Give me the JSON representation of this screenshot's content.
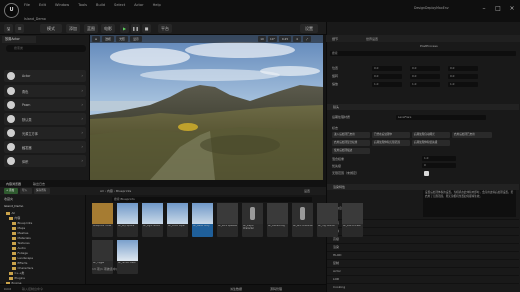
{
  "app": {
    "logo_text": "U",
    "project_name": "Island_Demo",
    "project_badge": "DesignDeployMaxEnv",
    "menu": [
      "File",
      "Edit",
      "Window",
      "Tools",
      "Build",
      "Select",
      "Actor",
      "Help"
    ]
  },
  "toolbar": {
    "mode_label": "选择模式",
    "play_icon": "▶",
    "pause_icon": "❚❚",
    "stop_icon": "■",
    "buttons": [
      "保存",
      "模式",
      "添加",
      "蓝图",
      "电影",
      "▶",
      "❚❚",
      "■",
      "平台",
      "设置"
    ]
  },
  "place_actors": {
    "tab_label": "放置Actor",
    "search_placeholder": "搜索类",
    "section_header": "基础",
    "categories": [
      "Actor",
      "角色",
      "Pawn",
      "默认类",
      "光源立方体",
      "触发器",
      "体积"
    ]
  },
  "viewport": {
    "perspective_label": "透视",
    "lit_label": "光照",
    "show_label": "显示",
    "grid_value": "10",
    "angle_value": "10°",
    "scale_value": "0.25",
    "speed_value": "4"
  },
  "details": {
    "tab_label": "细节",
    "tab2_label": "世界设置",
    "actor_name": "PostProcess",
    "search_placeholder": "搜索",
    "transform": {
      "location_label": "位置",
      "rotation_label": "旋转",
      "scale_label": "缩放",
      "values": [
        "0.0",
        "0.0",
        "0.0",
        "0.0",
        "0.0",
        "0.0",
        "1.0",
        "1.0",
        "1.0"
      ]
    },
    "lens_section": "镜头",
    "lens_sub": "后期处理材质",
    "lens_dropdown": "LensFlare",
    "flags_label": "标志",
    "flags": [
      "进入后处理已启用",
      "已经在后处理中",
      "后期处理自动曝光",
      "启用后处理已启用"
    ],
    "flags2": [
      "启用后处理混合权重",
      "后期处理体积无限范围",
      "后期处理体积优先级",
      "使用后处理描边"
    ],
    "blend_weight_label": "混合权重",
    "blend_weight_value": "1.0",
    "priority_label": "优先级",
    "priority_value": "0",
    "extent_label": "无限范围（未绑定）",
    "section_render": "渲染特性",
    "info_text": "设置后处理体积的设置。当相机在此体积内部时，会应用这些后处理设置。若启用了无限范围，则无论相机位置如何都将生效。",
    "info_label": "信息",
    "collapsed_sections": [
      "体积",
      "碰撞",
      "高级",
      "渲染",
      "HLOD",
      "复制",
      "Actor",
      "LOD",
      "Cooking"
    ]
  },
  "content_browser": {
    "tabs": [
      "内容浏览器",
      "输出日志"
    ],
    "add_button": "+ 添加",
    "import_button": "导入",
    "save_all_button": "保存所有",
    "path": [
      "All",
      "内容",
      "Blueprints"
    ],
    "settings_label": "设置",
    "search_placeholder": "搜索 Blueprints",
    "tree_header": "收藏夹",
    "tree_root": "Island_Demo",
    "folders": [
      "All",
      "内容",
      "Blueprints",
      "Maps",
      "Meshes",
      "Materials",
      "Textures",
      "Audio",
      "Foliage",
      "Landscape",
      "Effects",
      "Characters",
      "C++类",
      "Plugins",
      "Engine"
    ],
    "assets": [
      {
        "label": "Blueprints\nFolder",
        "kind": "folder"
      },
      {
        "label": "BP_Sky\nSphere",
        "kind": "sky"
      },
      {
        "label": "BP_Light\nStudio",
        "kind": "sky"
      },
      {
        "label": "BP_Cloud\nLayer",
        "kind": "sky"
      },
      {
        "label": "BP_Water\nBody",
        "kind": "sky-selected"
      },
      {
        "label": "BP_Rock\nSpawner",
        "kind": "dark"
      },
      {
        "label": "BP_Player\nCharacter",
        "kind": "char"
      },
      {
        "label": "BP_Camera\nRig",
        "kind": "dark"
      },
      {
        "label": "BP_NPC\nCharacter",
        "kind": "char"
      },
      {
        "label": "BP_Fog\nVolume",
        "kind": "dark"
      },
      {
        "label": "BP_Post\nProcess",
        "kind": "dark"
      },
      {
        "label": "BP_Trigger",
        "kind": "dark2"
      },
      {
        "label": "BP_Terrain\nMesh",
        "kind": "sky2"
      }
    ],
    "item_count": "13 项(1 项被选中)"
  },
  "status": {
    "cmd_label": "Cmd",
    "cmd_placeholder": "输入控制台命令",
    "derived": "派生数据",
    "source": "源码管理"
  }
}
